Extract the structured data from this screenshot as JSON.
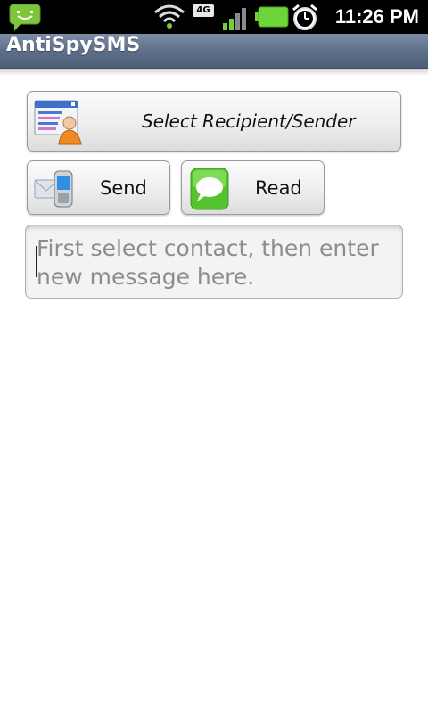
{
  "status_bar": {
    "time": "11:26 PM",
    "network_badge": "4G",
    "icons": [
      "sms-notification-icon",
      "wifi-icon",
      "network-4g-icon",
      "signal-icon",
      "battery-icon",
      "alarm-clock-icon"
    ],
    "colors": {
      "sms_green": "#7dc53b",
      "battery_green": "#6fd33a"
    }
  },
  "title_bar": {
    "title": "AntiSpySMS"
  },
  "buttons": {
    "select_contact_label": "Select Recipient/Sender",
    "send_label": "Send",
    "read_label": "Read"
  },
  "message": {
    "placeholder": "First select contact, then enter new message here.",
    "value": ""
  }
}
